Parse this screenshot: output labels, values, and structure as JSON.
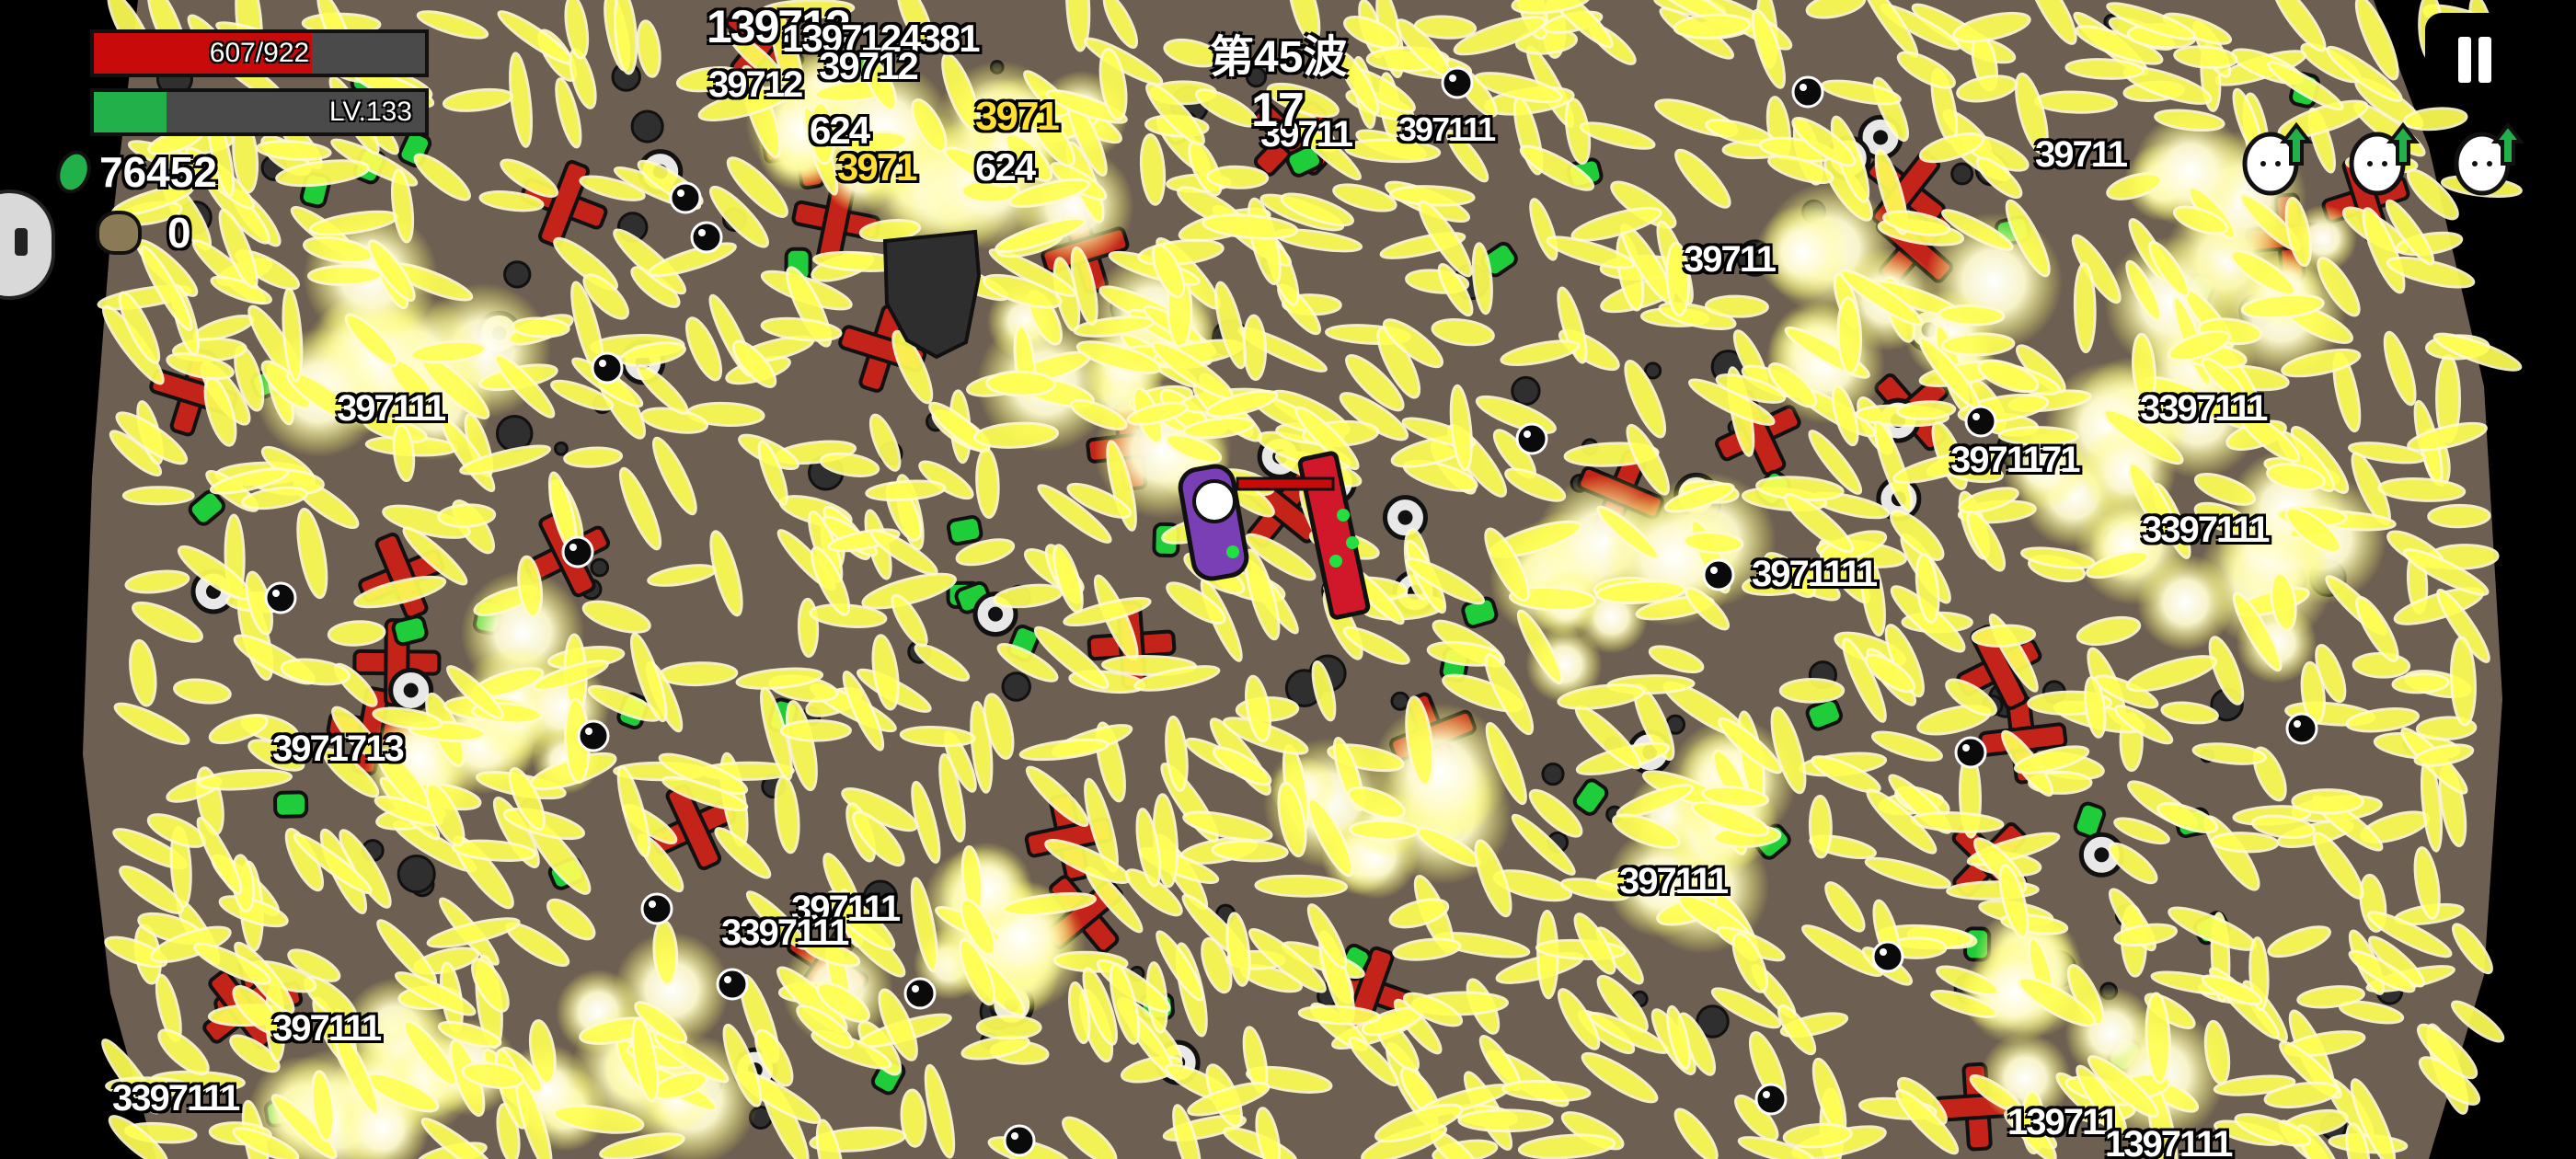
{
  "hud": {
    "hp_text": "607/922",
    "hp_fraction": 0.658,
    "level_text": "LV.133",
    "xp_fraction": 0.22,
    "gems_text": "76452",
    "coins_text": "0",
    "colors": {
      "hp": "#c80a0a",
      "xp": "#21b04a",
      "bar_bg": "#4a4a4a"
    }
  },
  "wave": {
    "label": "第45波",
    "timer": "17"
  },
  "pause": {
    "icon": "pause-icon"
  },
  "upgrades": [
    {
      "icon": "egg-upgrade-icon"
    },
    {
      "icon": "egg-upgrade-icon"
    },
    {
      "icon": "egg-upgrade-icon"
    }
  ],
  "damage_numbers": [
    "139712",
    "1397124381",
    "39712",
    "39712",
    "3971",
    "624",
    "3971",
    "624",
    "39711",
    "39711",
    "39711",
    "397111",
    "3397111",
    "3971171",
    "3397111",
    "3971111",
    "3971713",
    "397111",
    "397111",
    "3397111",
    "397111",
    "3397111",
    "139711",
    "1397111",
    "397111"
  ],
  "colors": {
    "ground": "#6d5f52",
    "projectile": "#ffff55",
    "projectile_glow": "#fffbd0",
    "enemy_red": "#c4231a",
    "enemy_green": "#1fcc3a",
    "crit_text": "#ffe033"
  }
}
